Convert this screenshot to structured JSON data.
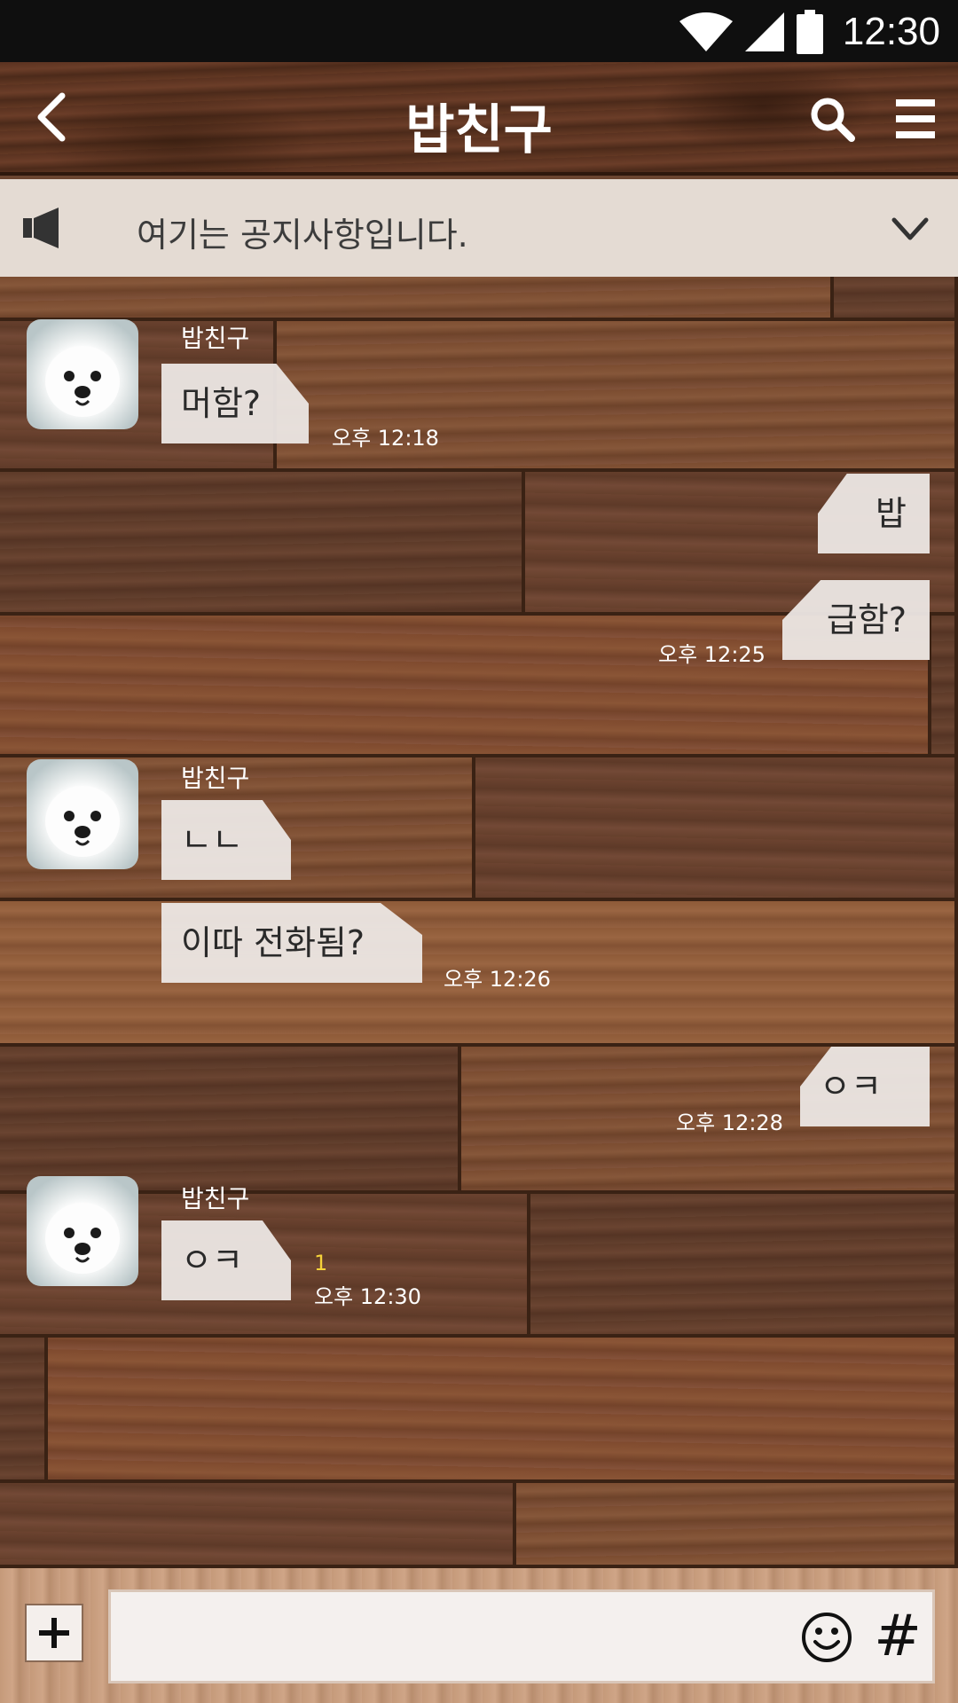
{
  "status_bar": {
    "time": "12:30",
    "icons": [
      "wifi-icon",
      "cell-signal-icon",
      "battery-icon"
    ]
  },
  "header": {
    "title": "밥친구"
  },
  "notice": {
    "text": "여기는 공지사항입니다."
  },
  "messages": [
    {
      "side": "left",
      "sender": "밥친구",
      "text": "머함?",
      "time": "오후 12:18"
    },
    {
      "side": "right",
      "text": "밥"
    },
    {
      "side": "right",
      "text": "급함?",
      "time": "오후 12:25"
    },
    {
      "side": "left",
      "sender": "밥친구",
      "text": "ㄴㄴ"
    },
    {
      "side": "left",
      "text": "이따 전화됨?",
      "time": "오후 12:26"
    },
    {
      "side": "right",
      "text": "ㅇㅋ",
      "time": "오후 12:28"
    },
    {
      "side": "left",
      "sender": "밥친구",
      "text": "ㅇㅋ",
      "unread": "1",
      "time": "오후 12:30"
    }
  ],
  "input": {
    "value": "",
    "placeholder": "",
    "hash_label": "#"
  },
  "colors": {
    "bubble": "#ECE7E4",
    "unread": "#F5D23A",
    "status_bar": "#0F0F0F"
  }
}
